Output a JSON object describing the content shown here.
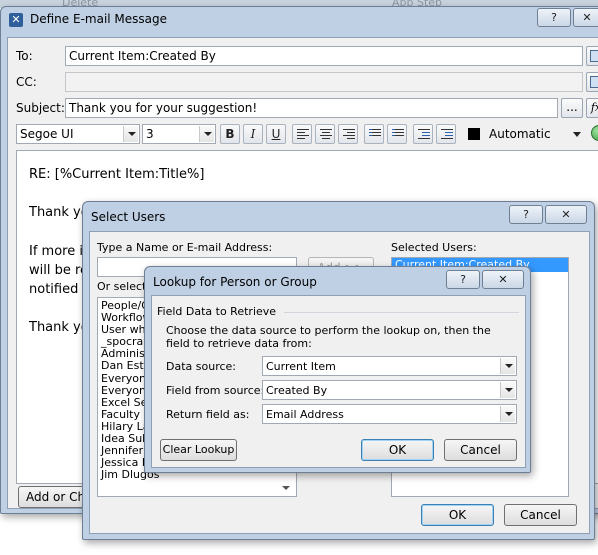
{
  "background_strip": {
    "items": [
      "Delete",
      "App Step"
    ]
  },
  "email_window": {
    "title": "Define E-mail Message",
    "help_label": "?",
    "close_label": "✕",
    "to_label": "To:",
    "to_value": "Current Item:Created By",
    "cc_label": "CC:",
    "cc_value": "",
    "subject_label": "Subject:",
    "subject_value": "Thank you for your suggestion!",
    "subject_browse_label": "...",
    "subject_formula_label": "fx",
    "font_name": "Segoe UI",
    "font_size": "3",
    "bold_label": "B",
    "italic_label": "I",
    "underline_label": "U",
    "color_label": "Automatic",
    "body_lines": [
      "RE: [%Current Item:Title%]",
      "Thank yo",
      "If more i",
      "will be re",
      "notified",
      "Thank yo"
    ],
    "add_or_change_label": "Add or Chan"
  },
  "select_users": {
    "title": "Select Users",
    "help_label": "?",
    "close_label": "✕",
    "type_name_label": "Type a Name or E-mail Address:",
    "or_select_label": "Or select",
    "add_button": "Add >>",
    "selected_users_label": "Selected Users:",
    "selected_items": [
      "Current Item:Created By"
    ],
    "list_items": [
      "People/G",
      "Workflow",
      "User who",
      "_spocraw",
      "Administr",
      "Dan Este",
      "Everyone",
      "Everyone",
      "Excel Ser",
      "Faculty",
      "Hilary Lar",
      "Idea Sub",
      "Jennifer",
      "Jessica Neuman",
      "Jim Dlugos"
    ],
    "ok_label": "OK",
    "cancel_label": "Cancel"
  },
  "lookup": {
    "title": "Lookup for Person or Group",
    "help_label": "?",
    "close_label": "✕",
    "section_title": "Field Data to Retrieve",
    "description": "Choose the data source to perform the lookup on, then the field to retrieve data from:",
    "data_source_label": "Data source:",
    "data_source_value": "Current Item",
    "field_from_source_label": "Field from source:",
    "field_from_source_value": "Created By",
    "return_field_label": "Return field as:",
    "return_field_value": "Email Address",
    "clear_lookup_label": "Clear Lookup",
    "ok_label": "OK",
    "cancel_label": "Cancel"
  }
}
